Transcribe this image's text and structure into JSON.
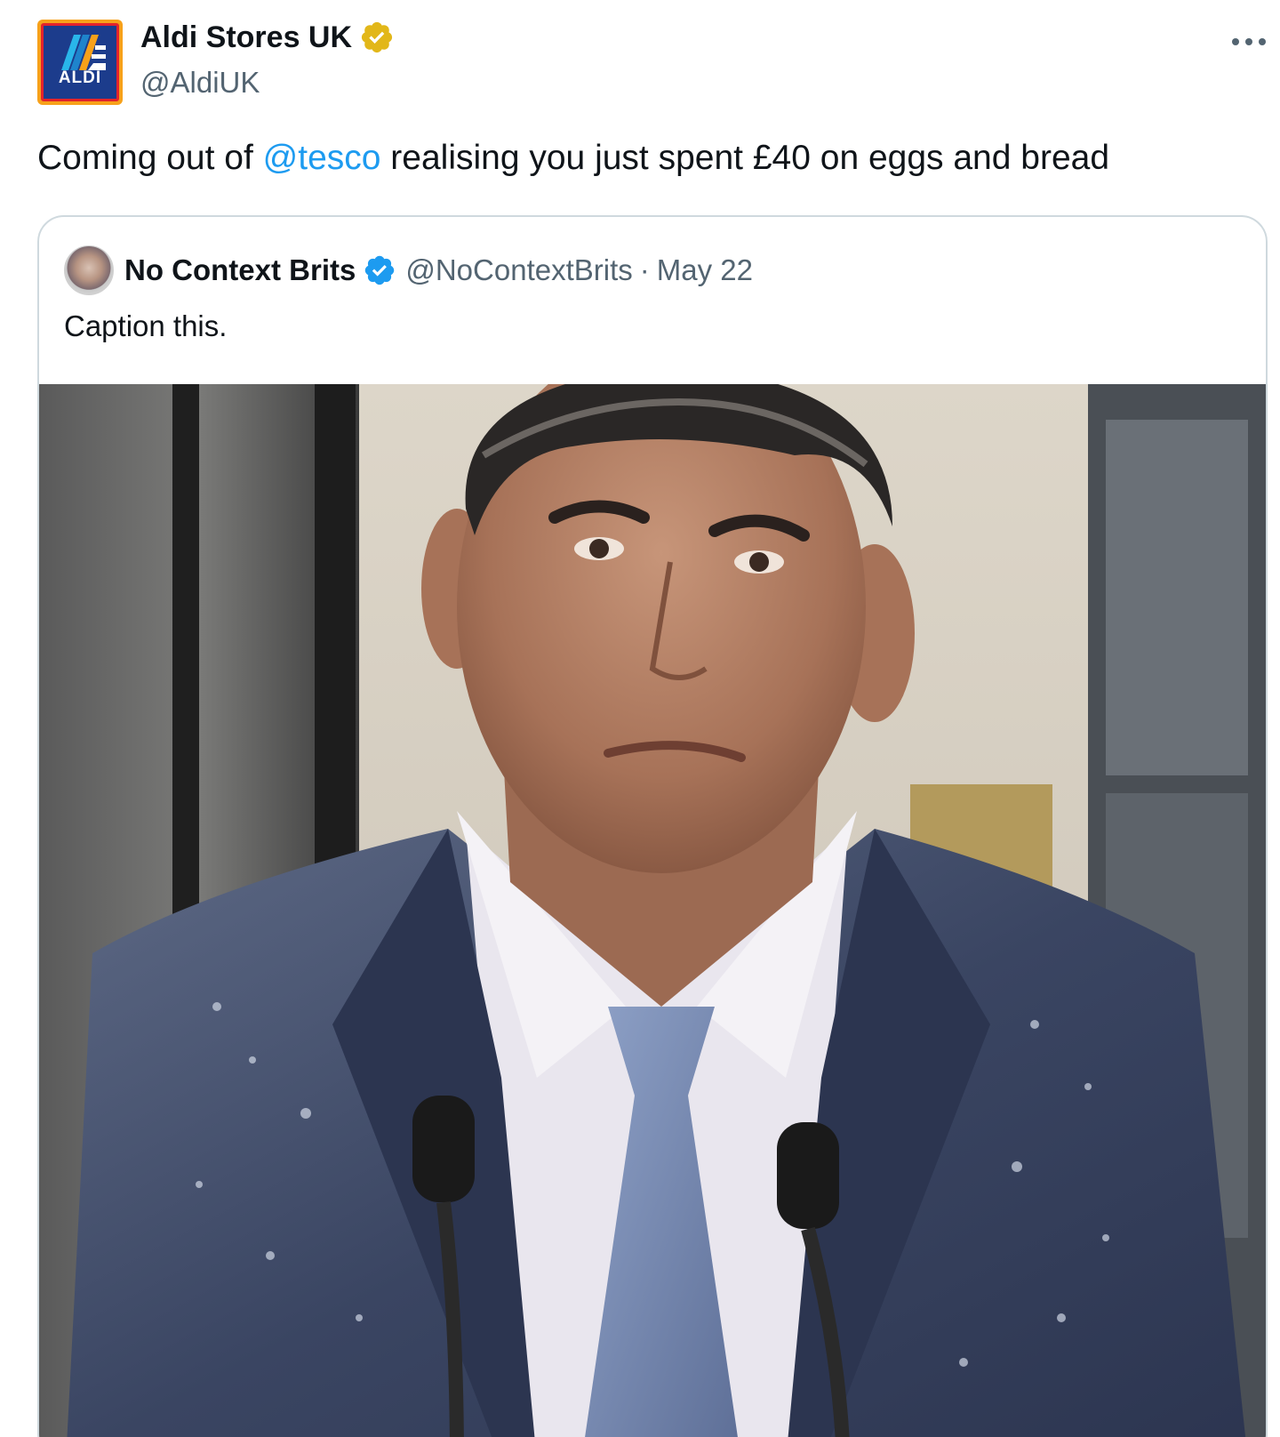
{
  "author": {
    "display_name": "Aldi Stores UK",
    "handle": "@AldiUK",
    "avatar_text": "ALDI",
    "verified_icon": "verified-gold-icon"
  },
  "tweet": {
    "text_before": "Coming out of ",
    "mention": "@tesco",
    "text_after": " realising you just spent £40 on eggs and bread"
  },
  "more_menu": {
    "icon": "more-horizontal-icon"
  },
  "quoted_tweet": {
    "display_name": "No Context Brits",
    "handle": "@NoContextBrits",
    "separator": "·",
    "date": "May 22",
    "text": "Caption this.",
    "verified_icon": "verified-blue-icon"
  },
  "colors": {
    "link": "#1d9bf0",
    "secondary_text": "#536471",
    "verified_gold": "#e2b719",
    "verified_blue": "#1d9bf0",
    "aldi_blue": "#1c3c8c",
    "aldi_orange": "#f7a11a",
    "aldi_red": "#e3232c"
  }
}
